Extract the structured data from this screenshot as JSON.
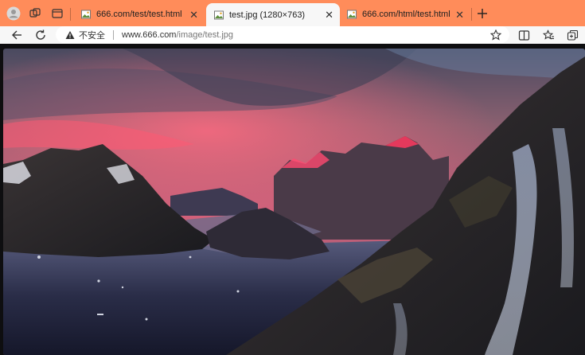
{
  "tabs": [
    {
      "label": "666.com/test/test.html",
      "active": false
    },
    {
      "label": "test.jpg (1280×763)",
      "active": true
    },
    {
      "label": "666.com/html/test.html",
      "active": false
    }
  ],
  "address_bar": {
    "security_label": "不安全",
    "url_host": "www.666.com",
    "url_path": "/image/test.jpg"
  },
  "image": {
    "description_icon": "landscape-photo"
  },
  "colors": {
    "tabstrip": "#ff8c5a",
    "toolbar": "#f7f7f7",
    "content_bg": "#0e0e10"
  }
}
